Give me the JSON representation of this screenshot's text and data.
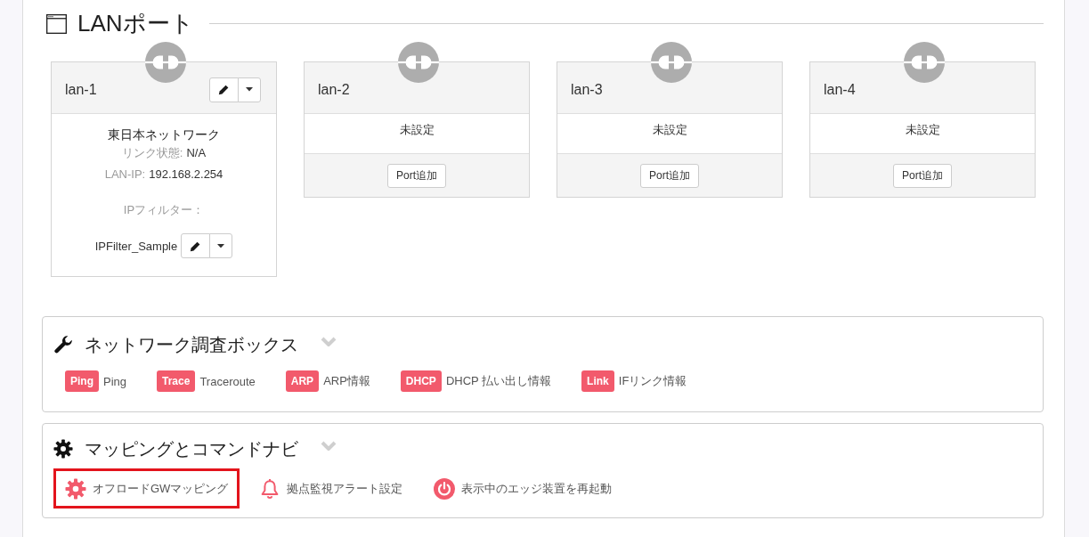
{
  "lan_section": {
    "title": "LANポート",
    "ports": [
      {
        "kind": "assigned",
        "name": "lan-1",
        "network": "東日本ネットワーク",
        "link_label": "リンク状態:",
        "link_value": "N/A",
        "ip_label": "LAN-IP:",
        "ip_value": "192.168.2.254",
        "filter_label": "IPフィルター：",
        "filter_value": "IPFilter_Sample"
      },
      {
        "kind": "unassigned",
        "name": "lan-2",
        "status": "未設定",
        "button": "Port追加"
      },
      {
        "kind": "unassigned",
        "name": "lan-3",
        "status": "未設定",
        "button": "Port追加"
      },
      {
        "kind": "unassigned",
        "name": "lan-4",
        "status": "未設定",
        "button": "Port追加"
      }
    ]
  },
  "network_box": {
    "title": "ネットワーク調査ボックス",
    "tools": [
      {
        "badge": "Ping",
        "label": "Ping"
      },
      {
        "badge": "Trace",
        "label": "Traceroute"
      },
      {
        "badge": "ARP",
        "label": "ARP情報"
      },
      {
        "badge": "DHCP",
        "label": "DHCP 払い出し情報"
      },
      {
        "badge": "Link",
        "label": "IFリンク情報"
      }
    ]
  },
  "mapping_box": {
    "title": "マッピングとコマンドナビ",
    "items": [
      {
        "kind": "gear",
        "label": "オフロードGWマッピング",
        "highlighted": true
      },
      {
        "kind": "bell",
        "label": "拠点監視アラート設定",
        "highlighted": false
      },
      {
        "kind": "power",
        "label": "表示中のエッジ装置を再起動",
        "highlighted": false
      }
    ]
  }
}
